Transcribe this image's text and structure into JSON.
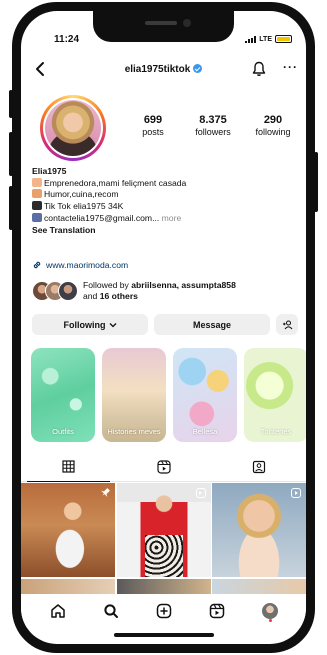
{
  "status": {
    "time": "11:24",
    "network": "LTE"
  },
  "header": {
    "username": "elia1975tiktok"
  },
  "stats": [
    {
      "value": "699",
      "label": "posts"
    },
    {
      "value": "8.375",
      "label": "followers"
    },
    {
      "value": "290",
      "label": "following"
    }
  ],
  "bio": {
    "name": "Elia1975",
    "lines": [
      "Emprenedora,mami feliçment casada",
      "Humor,cuina,recom",
      "Tik Tok elia1975 34K",
      "contactelia1975@gmail.com..."
    ],
    "more": "more",
    "see_translation": "See Translation"
  },
  "link": {
    "text": "www.maorimoda.com"
  },
  "followed_by": {
    "prefix": "Followed by",
    "names": "abriilsenna, assumpta858",
    "and": "and",
    "others": "16 others"
  },
  "buttons": {
    "following": "Following",
    "message": "Message"
  },
  "highlights": [
    {
      "label": "Outfits"
    },
    {
      "label": "Histories meves"
    },
    {
      "label": "Bellesa"
    },
    {
      "label": "Tonteries"
    }
  ],
  "tabs": [
    {
      "icon": "grid-icon",
      "active": true
    },
    {
      "icon": "reels-icon",
      "active": false
    },
    {
      "icon": "tagged-icon",
      "active": false
    }
  ],
  "bottom_nav": [
    "home-icon",
    "search-icon",
    "create-icon",
    "reels-icon",
    "profile-icon"
  ],
  "colors": {
    "verified": "#3897f0",
    "link": "#00376b",
    "button_bg": "#efefef",
    "battery": "#f2c400"
  }
}
